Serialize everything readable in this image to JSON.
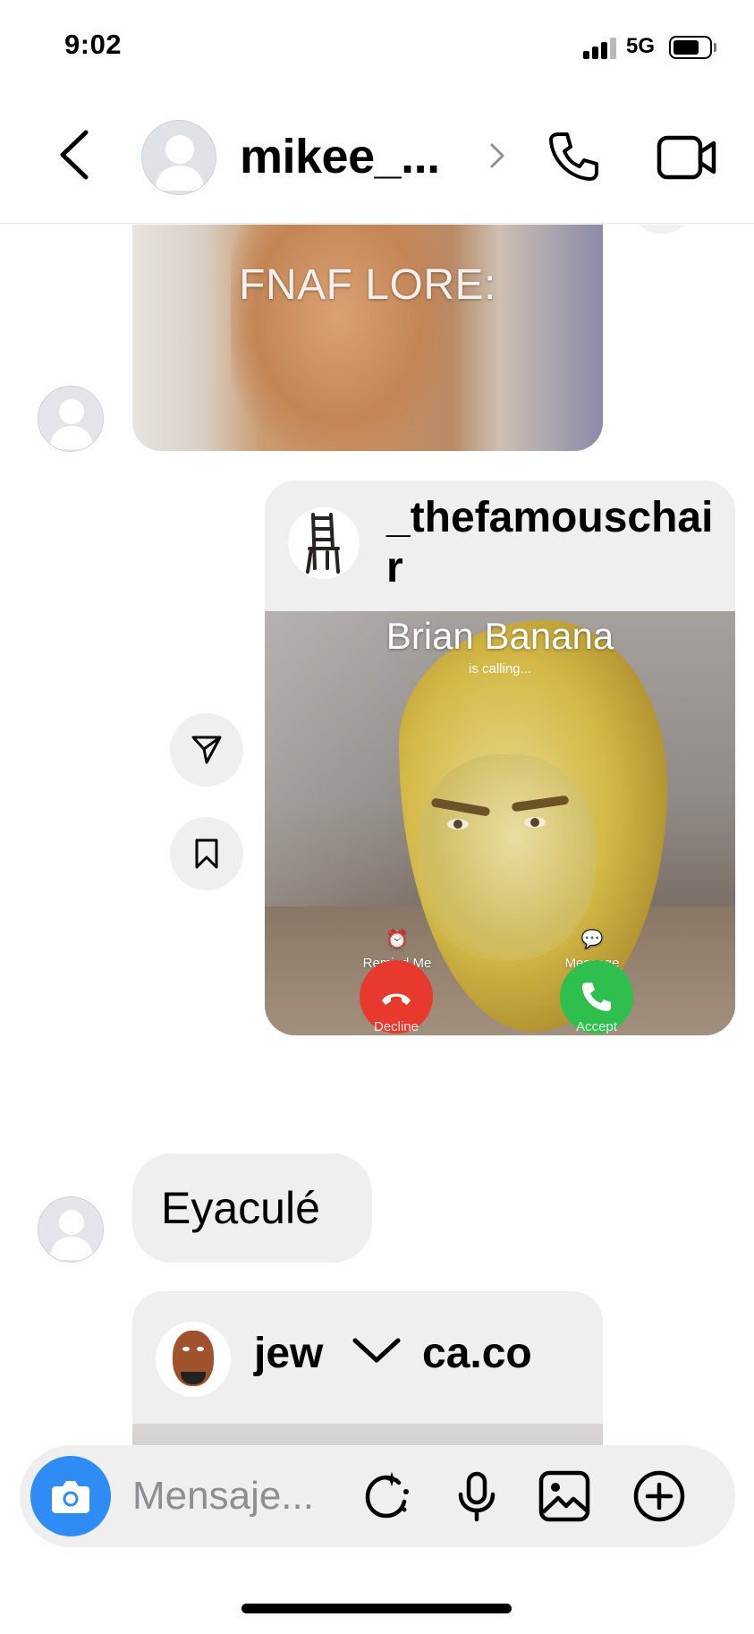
{
  "status_bar": {
    "time": "9:02",
    "network": "5G"
  },
  "header": {
    "username": "mikee_...",
    "icons": {
      "back": "chevron-left-icon",
      "profile_chevron": "chevron-right-icon",
      "call": "phone-icon",
      "video": "video-camera-icon"
    }
  },
  "chat": {
    "messages": [
      {
        "type": "media",
        "from": "them",
        "caption": "FNAF LORE:"
      },
      {
        "type": "shared_post",
        "from": "me",
        "author": "_thefamouschair",
        "image_text": {
          "caller_name": "Brian Banana",
          "caller_status": "is calling...",
          "remind": "Remind Me",
          "message": "Message",
          "decline": "Decline",
          "accept": "Accept"
        },
        "actions": [
          "share-icon",
          "bookmark-icon"
        ]
      },
      {
        "type": "text",
        "from": "them",
        "text": "Eyaculé"
      },
      {
        "type": "shared_post",
        "from": "them",
        "author_part_a": "jew",
        "author_part_b": "ca.co"
      }
    ]
  },
  "composer": {
    "placeholder": "Mensaje...",
    "icons": [
      "camera-icon",
      "sticker-icon",
      "microphone-icon",
      "gallery-icon",
      "plus-circle-icon"
    ]
  },
  "colors": {
    "accent": "#2f8cf5",
    "bubble": "#efeff0",
    "decline": "#e8392f",
    "accept": "#2fbf4f"
  }
}
